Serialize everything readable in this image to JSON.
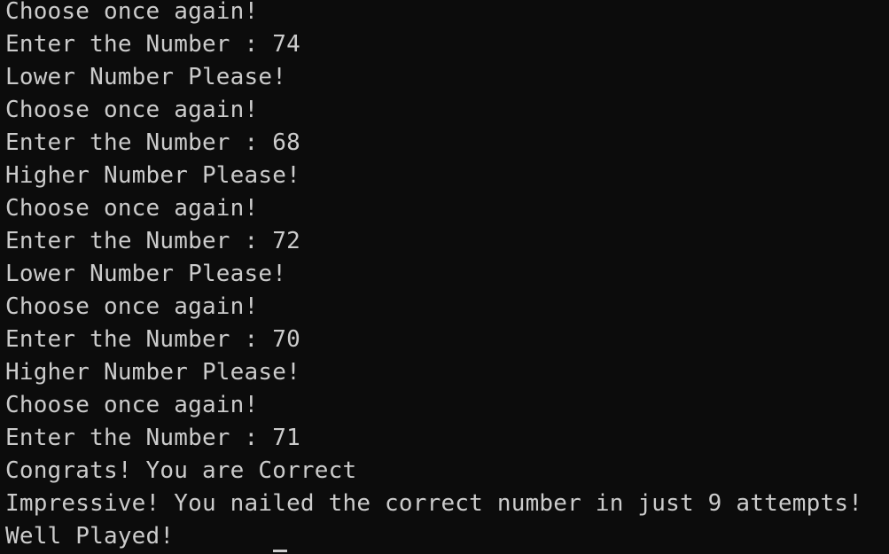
{
  "terminal": {
    "lines": [
      "Choose once again!",
      "Enter the Number : 74",
      "Lower Number Please!",
      "Choose once again!",
      "Enter the Number : 68",
      "Higher Number Please!",
      "Choose once again!",
      "Enter the Number : 72",
      "Lower Number Please!",
      "Choose once again!",
      "Enter the Number : 70",
      "Higher Number Please!",
      "Choose once again!",
      "Enter the Number : 71",
      "Congrats! You are Correct",
      "Impressive! You nailed the correct number in just 9 attempts!",
      "Well Played!"
    ],
    "colors": {
      "background": "#0c0c0c",
      "text": "#cccccc"
    }
  }
}
